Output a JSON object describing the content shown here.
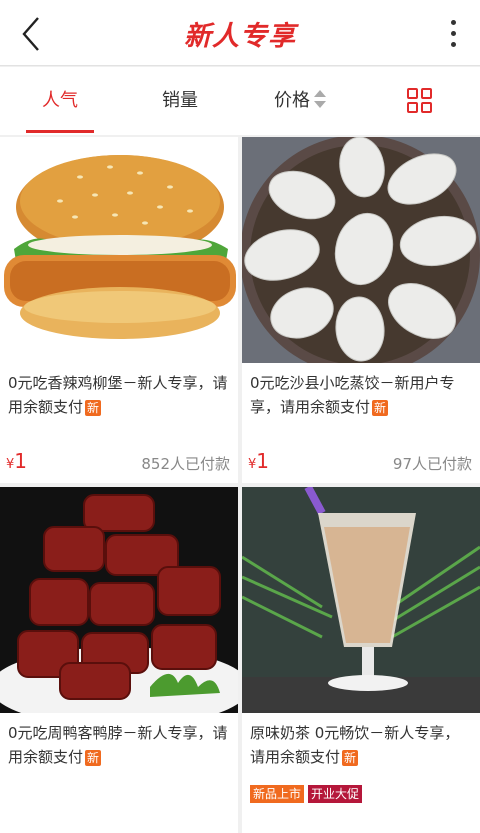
{
  "header": {
    "title": "新人专享",
    "back_icon": "back-chevron-icon",
    "more_icon": "more-vertical-icon"
  },
  "tabs": [
    {
      "label": "人气",
      "active": true
    },
    {
      "label": "销量",
      "active": false
    },
    {
      "label": "价格",
      "active": false
    }
  ],
  "colors": {
    "accent": "#e12a2a",
    "new_badge": "#f06a1f",
    "tag_red": "#b5173a"
  },
  "products": [
    {
      "name": "0元吃香辣鸡柳堡－新人专享，请用余额支付",
      "badge": "新",
      "price_symbol": "¥",
      "price": "1",
      "sold": "852人已付款",
      "image": "burger"
    },
    {
      "name": "0元吃沙县小吃蒸饺－新用户专享，请用余额支付",
      "badge": "新",
      "price_symbol": "¥",
      "price": "1",
      "sold": "97人已付款",
      "image": "dumplings"
    },
    {
      "name": "0元吃周鸭客鸭脖－新人专享，请用余额支付",
      "badge": "新",
      "image": "duck-neck"
    },
    {
      "name": "原味奶茶 0元畅饮－新人专享，请用余额支付",
      "badge": "新",
      "image": "milk-tea",
      "tags": [
        "新品上市",
        "开业大促"
      ]
    }
  ]
}
